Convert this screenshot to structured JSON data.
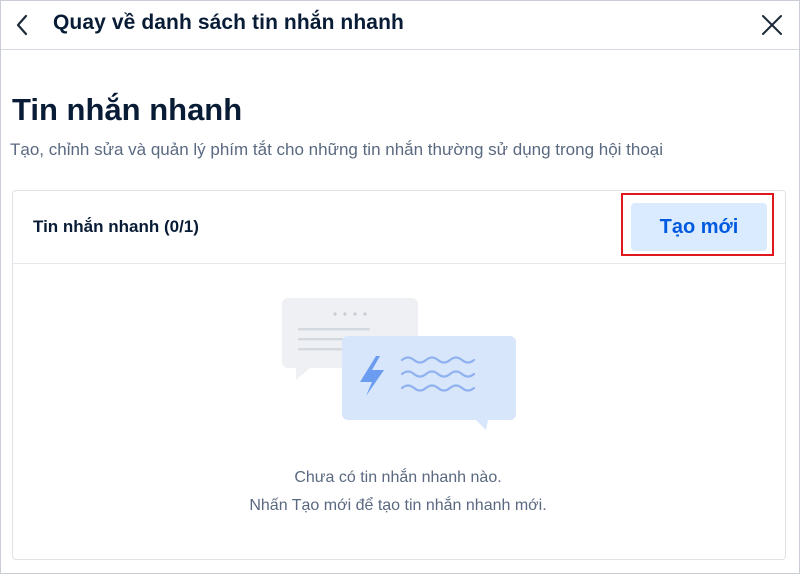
{
  "header": {
    "back_icon": "chevron-left-icon",
    "title": "Quay về danh sách tin nhắn nhanh",
    "close_icon": "close-icon"
  },
  "page": {
    "title": "Tin nhắn nhanh",
    "description": "Tạo, chỉnh sửa và quản lý phím tắt cho những tin nhắn thường sử dụng trong hội thoại"
  },
  "card": {
    "header_label": "Tin nhắn nhanh (0/1)",
    "create_button_label": "Tạo mới",
    "empty_illustration": "quick-message-bubbles-illustration",
    "empty_line1": "Chưa có tin nhắn nhanh nào.",
    "empty_line2": "Nhấn Tạo mới để tạo tin nhắn nhanh mới."
  },
  "colors": {
    "primary_text": "#081c36",
    "secondary_text": "#5a6981",
    "button_bg": "#dbebff",
    "button_text": "#005ae0",
    "highlight_border": "#e0181d"
  }
}
